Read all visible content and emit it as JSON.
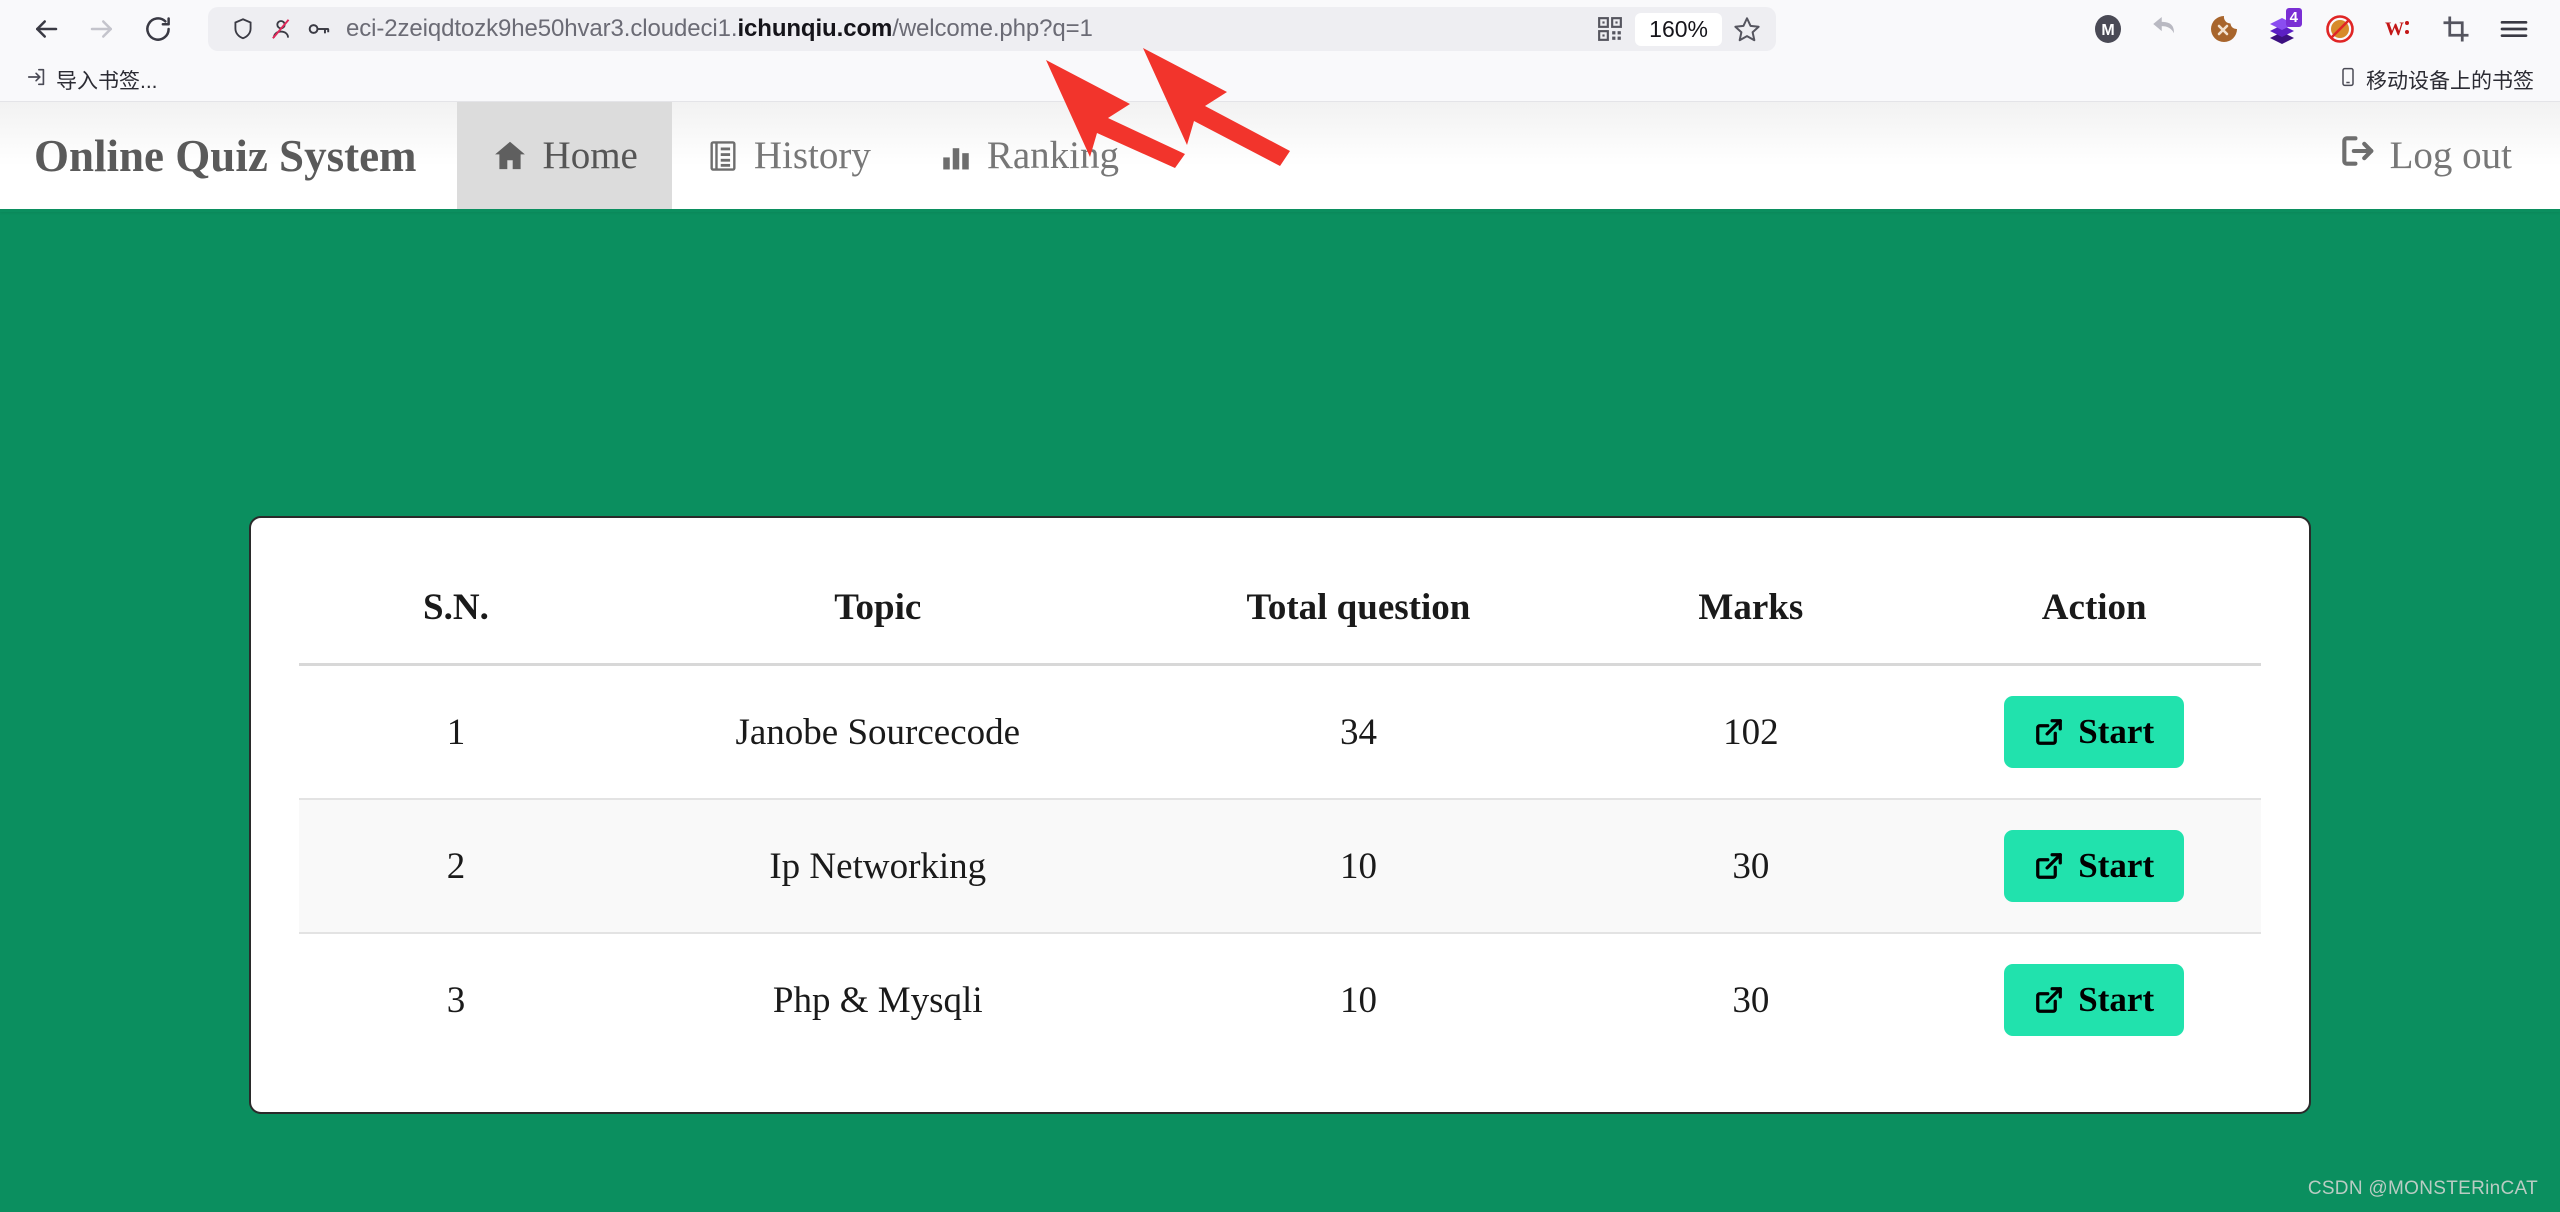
{
  "browser": {
    "nav": {
      "back_icon": "arrow-left-icon",
      "forward_icon": "arrow-right-icon",
      "reload_icon": "reload-icon"
    },
    "url_bar": {
      "shield_icon": "shield-icon",
      "tracker_icon": "tracker-blocked-icon",
      "key_icon": "key-icon",
      "url_prefix": "eci-2zeiqdtozk9he50hvar3.cloudeci1.",
      "url_host": "ichunqiu.com",
      "url_suffix": "/welcome.php?q=1",
      "full_url": "eci-2zeiqdtozk9he50hvar3.cloudeci1.ichunqiu.com/welcome.php?q=1",
      "qr_icon": "qr-code-icon",
      "zoom_level": "160%",
      "bookmark_icon": "star-icon"
    },
    "extensions": [
      {
        "name": "metamask-extension-icon",
        "label": "M",
        "badge": ""
      },
      {
        "name": "undo-extension-icon",
        "label": "",
        "badge": ""
      },
      {
        "name": "cookie-extension-icon",
        "label": "",
        "badge": ""
      },
      {
        "name": "purple-stack-extension-icon",
        "label": "",
        "badge": "4"
      },
      {
        "name": "blocked-extension-icon",
        "label": "",
        "badge": ""
      },
      {
        "name": "wappalyzer-extension-icon",
        "label": "W:",
        "badge": ""
      },
      {
        "name": "crop-extension-icon",
        "label": "",
        "badge": ""
      },
      {
        "name": "app-menu-icon",
        "label": "",
        "badge": ""
      }
    ],
    "bookmarks_bar": {
      "import_icon": "import-bookmarks-icon",
      "import_label": "导入书签...",
      "mobile_icon": "mobile-device-icon",
      "mobile_label": "移动设备上的书签"
    }
  },
  "site": {
    "brand": "Online Quiz System",
    "nav_items": [
      {
        "label": "Home",
        "icon": "home-icon",
        "active": true
      },
      {
        "label": "History",
        "icon": "list-icon",
        "active": false
      },
      {
        "label": "Ranking",
        "icon": "bar-chart-icon",
        "active": false
      }
    ],
    "logout": {
      "label": "Log out",
      "icon": "sign-out-icon"
    },
    "colors": {
      "page_background": "#0b8f5f",
      "navbar_active": "#dcdcdc",
      "start_button": "#21e2ad",
      "annotation_arrow": "#f2342c"
    },
    "watermark": "CSDN @MONSTERinCAT"
  },
  "quiz_table": {
    "headers": [
      "S.N.",
      "Topic",
      "Total question",
      "Marks",
      "Action"
    ],
    "rows": [
      {
        "sn": "1",
        "topic": "Janobe Sourcecode",
        "total": "34",
        "marks": "102",
        "action": "Start"
      },
      {
        "sn": "2",
        "topic": "Ip Networking",
        "total": "10",
        "marks": "30",
        "action": "Start"
      },
      {
        "sn": "3",
        "topic": "Php & Mysqli",
        "total": "10",
        "marks": "30",
        "action": "Start"
      }
    ],
    "action_icon": "external-link-icon"
  }
}
